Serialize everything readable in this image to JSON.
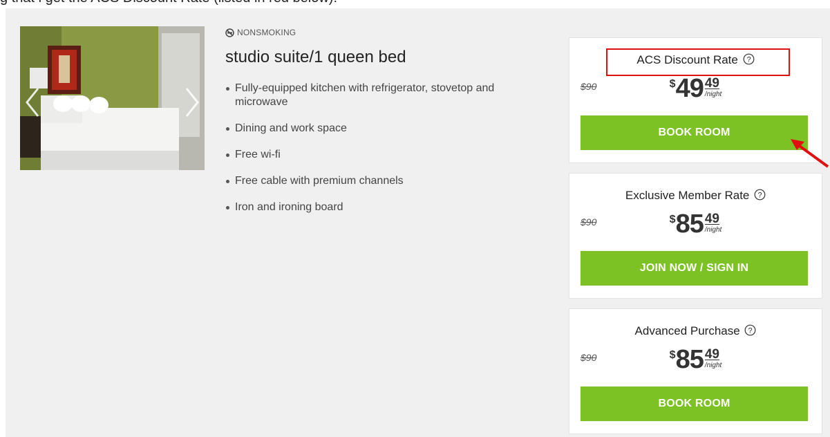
{
  "document": {
    "caption": "g that i get the ACS Discount Rate (listed in red below):"
  },
  "room": {
    "smoking_label": "NONSMOKING",
    "title": "studio suite/1 queen bed",
    "amenities": [
      "Fully-equipped kitchen with refrigerator, stovetop and microwave",
      "Dining and work space",
      "Free wi-fi",
      "Free cable with premium channels",
      "Iron and ironing board"
    ],
    "photo_icon": "hotel-room-photo",
    "prev_icon": "chevron-left-icon",
    "next_icon": "chevron-right-icon"
  },
  "rates": [
    {
      "name": "ACS Discount Rate",
      "old_price": "$90",
      "currency": "$",
      "whole": "49",
      "cents": "49",
      "unit": "/night",
      "button_label": "BOOK ROOM"
    },
    {
      "name": "Exclusive Member Rate",
      "old_price": "$90",
      "currency": "$",
      "whole": "85",
      "cents": "49",
      "unit": "/night",
      "button_label": "JOIN NOW / SIGN IN"
    },
    {
      "name": "Advanced Purchase",
      "old_price": "$90",
      "currency": "$",
      "whole": "85",
      "cents": "49",
      "unit": "/night",
      "button_label": "BOOK ROOM"
    }
  ],
  "colors": {
    "accent_green": "#7dc224",
    "annotation_red": "#e01010",
    "panel_bg": "#f0f0f0"
  }
}
